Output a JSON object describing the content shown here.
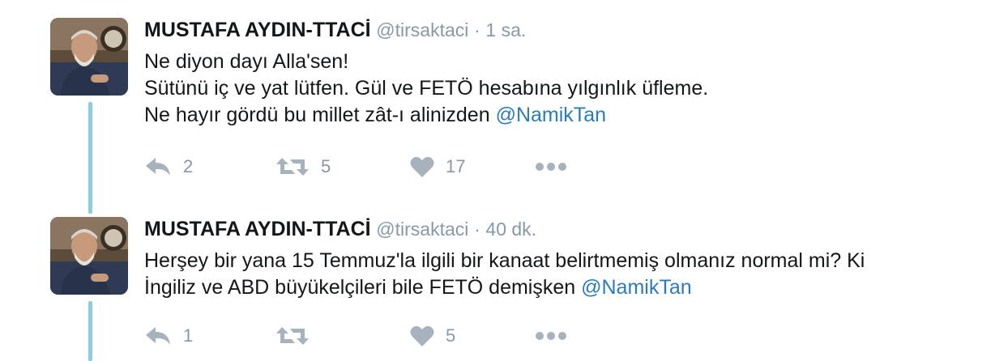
{
  "tweets": [
    {
      "author": {
        "display_name": "MUSTAFA AYDIN-TTACİ",
        "handle": "@tirsaktaci",
        "avatar_icon": "avatar-photo-icon"
      },
      "separator": "·",
      "time": "1 sa.",
      "text_lines": [
        "Ne diyon dayı Alla'sen!",
        "Sütünü iç ve yat lütfen. Gül ve FETÖ hesabına yılgınlık üfleme.",
        "Ne hayır gördü bu millet zât-ı alinizden"
      ],
      "mention": "@NamikTan",
      "actions": {
        "reply_count": "2",
        "retweet_count": "5",
        "like_count": "17"
      }
    },
    {
      "author": {
        "display_name": "MUSTAFA AYDIN-TTACİ",
        "handle": "@tirsaktaci",
        "avatar_icon": "avatar-photo-icon"
      },
      "separator": "·",
      "time": "40 dk.",
      "text_lines": [
        "Herşey bir yana 15 Temmuz'la ilgili bir kanaat belirtmemiş olmanız normal mi? Ki",
        "İngiliz ve ABD büyükelçileri bile FETÖ demişken"
      ],
      "mention": "@NamikTan",
      "actions": {
        "reply_count": "1",
        "retweet_count": "",
        "like_count": "5"
      }
    }
  ],
  "colors": {
    "name": "#14171a",
    "meta": "#8899a6",
    "mention": "#2b7bb9",
    "thread_line": "#8ecde0",
    "action_icon": "#a7b2bc"
  },
  "icons": {
    "reply": "reply-icon",
    "retweet": "retweet-icon",
    "like": "heart-icon",
    "more": "more-dots-icon"
  }
}
